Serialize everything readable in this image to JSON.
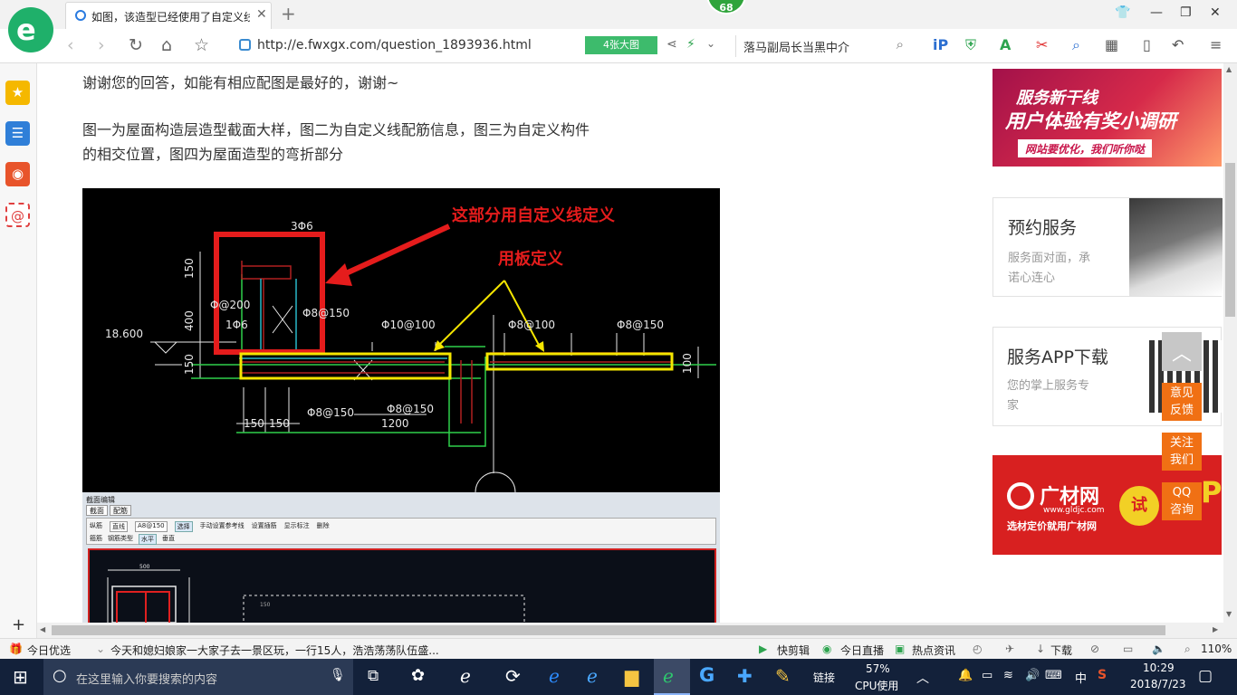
{
  "tab": {
    "title": "如图，该造型已经使用了自定义线"
  },
  "badge": {
    "count": "68"
  },
  "navbar": {
    "url": "http://e.fwxgx.com/question_1893936.html",
    "image_count": "4张大图",
    "search_text": "落马副局长当黑中介"
  },
  "article": {
    "line1": "谢谢您的回答，如能有相应配图是最好的，谢谢~",
    "line2": "图一为屋面构造层造型截面大样，图二为自定义线配筋信息，图三为自定义构件",
    "line3": "的相交位置，图四为屋面造型的弯折部分"
  },
  "cad": {
    "label_custom_line": "这部分用自定义线定义",
    "label_slab": "用板定义",
    "dims": {
      "d3phi6": "3Φ6",
      "d150a": "150",
      "d400": "400",
      "d150b": "150",
      "d200": "Φ@200",
      "d1phi6": "1Φ6",
      "d8150a": "Φ8@150",
      "elev": "18.600",
      "d10100": "Φ10@100",
      "d8100": "Φ8@100",
      "d8150b": "Φ8@150",
      "d8150c": "Φ8@150",
      "d8150d": "Φ8@150",
      "d1200": "1200",
      "d150c": "150",
      "d150d": "150",
      "d100": "100"
    }
  },
  "cad2": {
    "title": "截面编辑",
    "tab1": "截面",
    "tab2": "配筋",
    "toolbar": [
      "纵筋",
      "直线",
      "A8@150",
      "选择",
      "手动设置参考线",
      "设置插筋",
      "显示标注",
      "删除"
    ],
    "row2": [
      "箍筋",
      "钢筋类型",
      "水平",
      "垂直"
    ],
    "dim500": "500",
    "dim150": "150"
  },
  "sidebar": {
    "ad1_line1": "服务新干线",
    "ad1_line2": "用户体验有奖小调研",
    "ad1_line3": "网站要优化，我们听你哒",
    "card1_title": "预约服务",
    "card1_sub1": "服务面对面，承",
    "card1_sub2": "诺心连心",
    "card2_title": "服务APP下载",
    "card2_sub1": "您的掌上服务专",
    "card2_sub2": "家",
    "ad2_brand": "广材网",
    "ad2_url": "www.gldjc.com",
    "ad2_slogan": "选材定价就用广材网",
    "ad2_try": "试",
    "ad2_letter": "P"
  },
  "floating": {
    "feedback": [
      "意见",
      "反馈"
    ],
    "follow": [
      "关注",
      "我们"
    ],
    "qq": [
      "QQ",
      "咨询"
    ]
  },
  "statusbar": {
    "today": "今日优选",
    "news": "今天和媳妇娘家一大家子去一景区玩，一行15人，浩浩荡荡队伍盛...",
    "quickcut": "快剪辑",
    "live": "今日直播",
    "hotnews": "热点资讯",
    "download": "下载",
    "zoom": "110%"
  },
  "taskbar": {
    "search_placeholder": "在这里输入你要搜索的内容",
    "links": "链接",
    "cpu_percent": "57%",
    "cpu_label": "CPU使用",
    "ime": "中",
    "time": "10:29",
    "date": "2018/7/23"
  }
}
